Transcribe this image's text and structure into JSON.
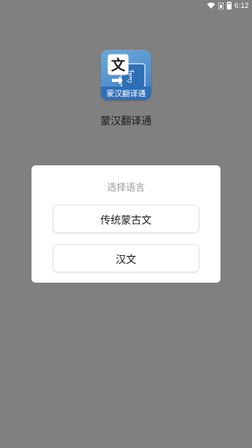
{
  "status_bar": {
    "time": "6:12",
    "icons": [
      "wifi-icon",
      "sim-icon",
      "battery-icon"
    ]
  },
  "app": {
    "name": "蒙汉翻译通",
    "logo": {
      "icon": "app-logo-icon",
      "glyph": "文",
      "caption": "蒙汉翻译通",
      "colors": {
        "top": "#6fa8d8",
        "bottom": "#3b7cc0",
        "banner": "#2f6fb5"
      }
    }
  },
  "dialog": {
    "title": "选择语言",
    "options": [
      {
        "label": "传统蒙古文"
      },
      {
        "label": "汉文"
      }
    ]
  },
  "colors": {
    "overlay": "#808080",
    "dialog_bg": "#ffffff",
    "title_text": "#9a9a9a",
    "button_text": "#1a1a1a"
  }
}
